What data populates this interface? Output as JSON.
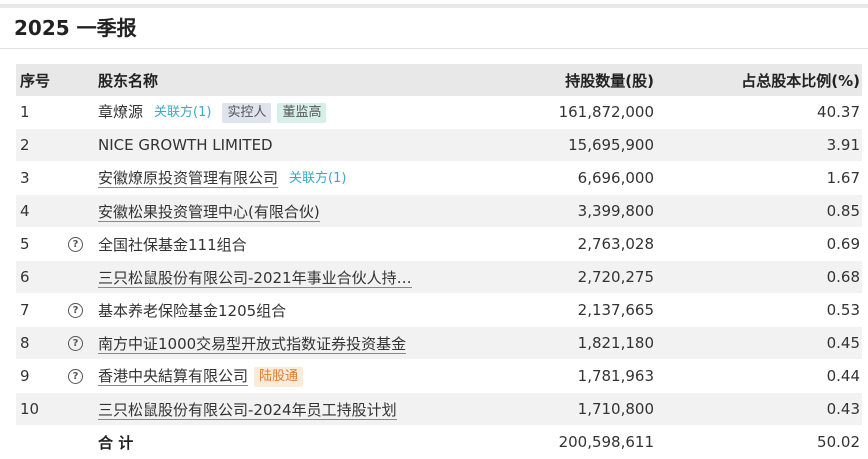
{
  "header": {
    "title": "2025 一季报"
  },
  "table": {
    "columns": {
      "index": "序号",
      "name": "股东名称",
      "shares": "持股数量(股)",
      "ratio": "占总股本比例(%)"
    },
    "rows": [
      {
        "index": "1",
        "help": false,
        "name": "章燎源",
        "link": false,
        "tags": [
          {
            "label": "关联方(1)",
            "kind": "rel"
          },
          {
            "label": "实控人",
            "kind": "ctrl"
          },
          {
            "label": "董监高",
            "kind": "exec"
          }
        ],
        "shares": "161,872,000",
        "ratio": "40.37"
      },
      {
        "index": "2",
        "help": false,
        "name": "NICE GROWTH LIMITED",
        "link": false,
        "tags": [],
        "shares": "15,695,900",
        "ratio": "3.91"
      },
      {
        "index": "3",
        "help": false,
        "name": "安徽燎原投资管理有限公司",
        "link": true,
        "tags": [
          {
            "label": "关联方(1)",
            "kind": "rel"
          }
        ],
        "shares": "6,696,000",
        "ratio": "1.67"
      },
      {
        "index": "4",
        "help": false,
        "name": "安徽松果投资管理中心(有限合伙)",
        "link": true,
        "tags": [],
        "shares": "3,399,800",
        "ratio": "0.85"
      },
      {
        "index": "5",
        "help": true,
        "name": "全国社保基金111组合",
        "link": false,
        "tags": [],
        "shares": "2,763,028",
        "ratio": "0.69"
      },
      {
        "index": "6",
        "help": false,
        "name": "三只松鼠股份有限公司-2021年事业合伙人持…",
        "link": true,
        "tags": [],
        "shares": "2,720,275",
        "ratio": "0.68"
      },
      {
        "index": "7",
        "help": true,
        "name": "基本养老保险基金1205组合",
        "link": false,
        "tags": [],
        "shares": "2,137,665",
        "ratio": "0.53"
      },
      {
        "index": "8",
        "help": true,
        "name": "南方中证1000交易型开放式指数证券投资基金",
        "link": true,
        "tags": [],
        "shares": "1,821,180",
        "ratio": "0.45"
      },
      {
        "index": "9",
        "help": true,
        "name": "香港中央結算有限公司",
        "link": true,
        "tags": [
          {
            "label": "陆股通",
            "kind": "hk"
          }
        ],
        "shares": "1,781,963",
        "ratio": "0.44"
      },
      {
        "index": "10",
        "help": false,
        "name": "三只松鼠股份有限公司-2024年员工持股计划",
        "link": true,
        "tags": [],
        "shares": "1,710,800",
        "ratio": "0.43"
      }
    ],
    "total": {
      "label": "合 计",
      "shares": "200,598,611",
      "ratio": "50.02"
    }
  },
  "icons": {
    "help": "question-circle-icon"
  },
  "colors": {
    "related_tag": "#3aa8c9",
    "hk_tag": "#e37a2b",
    "header_bg": "#e8e8e8",
    "stripe_bg": "#f2f2f2"
  }
}
